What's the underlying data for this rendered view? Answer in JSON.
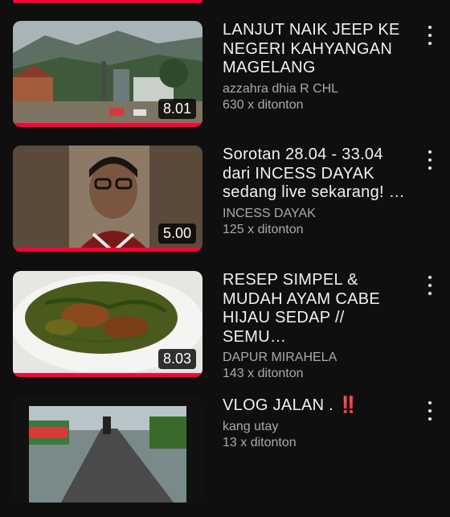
{
  "videos": [
    {
      "title": "LANJUT NAIK JEEP KE NEGERI KAHYANGAN MAGELANG",
      "channel": "azzahra dhia R CHL",
      "views": "630 x ditonton",
      "duration": "8.01",
      "progress": 1.0,
      "thumbnail_icon": "mountain-village-thumbnail"
    },
    {
      "title": "Sorotan 28.04 - 33.04 dari INCESS DAYAK sedang live sekarang! …",
      "channel": "INCESS DAYAK",
      "views": "125 x ditonton",
      "duration": "5.00",
      "progress": 1.0,
      "thumbnail_icon": "woman-portrait-thumbnail"
    },
    {
      "title": "RESEP SIMPEL & MUDAH AYAM CABE HIJAU SEDAP // SEMU…",
      "channel": "DAPUR MIRAHELA",
      "views": "143 x ditonton",
      "duration": "8.03",
      "progress": 1.0,
      "thumbnail_icon": "chicken-dish-thumbnail"
    },
    {
      "title": "VLOG JALAN . ‼️",
      "channel": "kang utay",
      "views": "13 x ditonton",
      "duration": "",
      "progress": 0,
      "thumbnail_icon": "road-motorcycle-thumbnail"
    }
  ],
  "colors": {
    "background": "#0f0f0f",
    "progress": "#ff0033",
    "secondary_text": "#aaaaaa"
  }
}
